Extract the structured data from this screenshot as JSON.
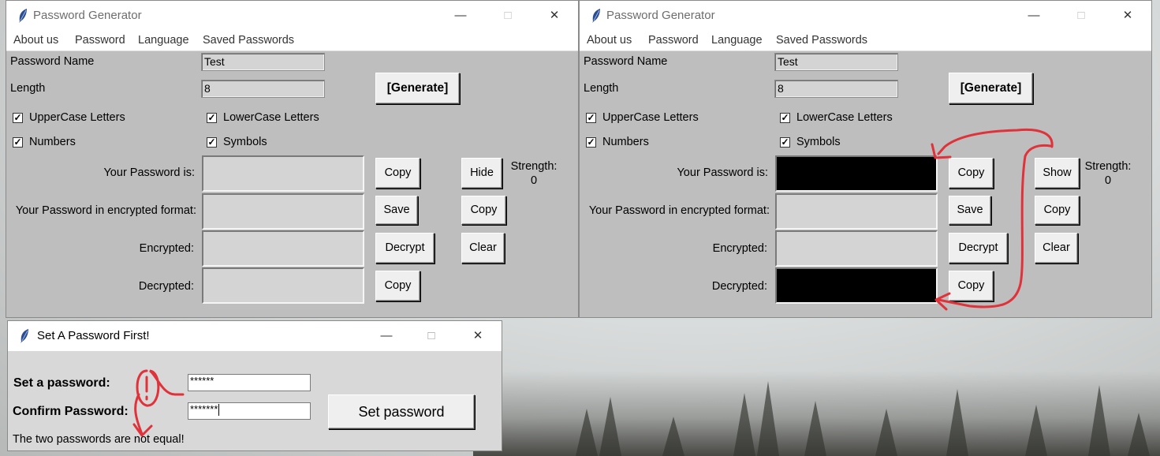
{
  "colors": {
    "annotation": "#e0323a",
    "window_bg": "#bebebe",
    "masked_field": "#000000"
  },
  "main_windows": [
    {
      "title": "Password Generator",
      "menu": [
        "About us",
        "Password",
        "Language",
        "Saved Passwords"
      ],
      "password_name_label": "Password Name",
      "password_name_value": "Test",
      "length_label": "Length",
      "length_value": "8",
      "generate_label": "[Generate]",
      "uppercase_label": "UpperCase Letters",
      "lowercase_label": "LowerCase Letters",
      "numbers_label": "Numbers",
      "symbols_label": "Symbols",
      "checks": {
        "uppercase": true,
        "lowercase": true,
        "numbers": true,
        "symbols": true
      },
      "your_password_label": "Your Password is:",
      "encrypted_format_label": "Your Password in encrypted format:",
      "encrypted_label": "Encrypted:",
      "decrypted_label": "Decrypted:",
      "copy_label": "Copy",
      "save_label": "Save",
      "decrypt_label": "Decrypt",
      "toggle_label": "Hide",
      "copy2_label": "Copy",
      "clear_label": "Clear",
      "copy3_label": "Copy",
      "strength_label": "Strength:",
      "strength_value": "0",
      "password_masked": false
    },
    {
      "title": "Password Generator",
      "menu": [
        "About us",
        "Password",
        "Language",
        "Saved Passwords"
      ],
      "password_name_label": "Password Name",
      "password_name_value": "Test",
      "length_label": "Length",
      "length_value": "8",
      "generate_label": "[Generate]",
      "uppercase_label": "UpperCase Letters",
      "lowercase_label": "LowerCase Letters",
      "numbers_label": "Numbers",
      "symbols_label": "Symbols",
      "checks": {
        "uppercase": true,
        "lowercase": true,
        "numbers": true,
        "symbols": true
      },
      "your_password_label": "Your Password is:",
      "encrypted_format_label": "Your Password in encrypted format:",
      "encrypted_label": "Encrypted:",
      "decrypted_label": "Decrypted:",
      "copy_label": "Copy",
      "save_label": "Save",
      "decrypt_label": "Decrypt",
      "toggle_label": "Show",
      "copy2_label": "Copy",
      "clear_label": "Clear",
      "copy3_label": "Copy",
      "strength_label": "Strength:",
      "strength_value": "0",
      "password_masked": true
    }
  ],
  "dialog": {
    "title": "Set A Password First!",
    "set_label": "Set a password:",
    "set_value": "******",
    "confirm_label": "Confirm Password:",
    "confirm_value": "*******",
    "button_label": "Set password",
    "error_message": "The two passwords are not equal!"
  }
}
